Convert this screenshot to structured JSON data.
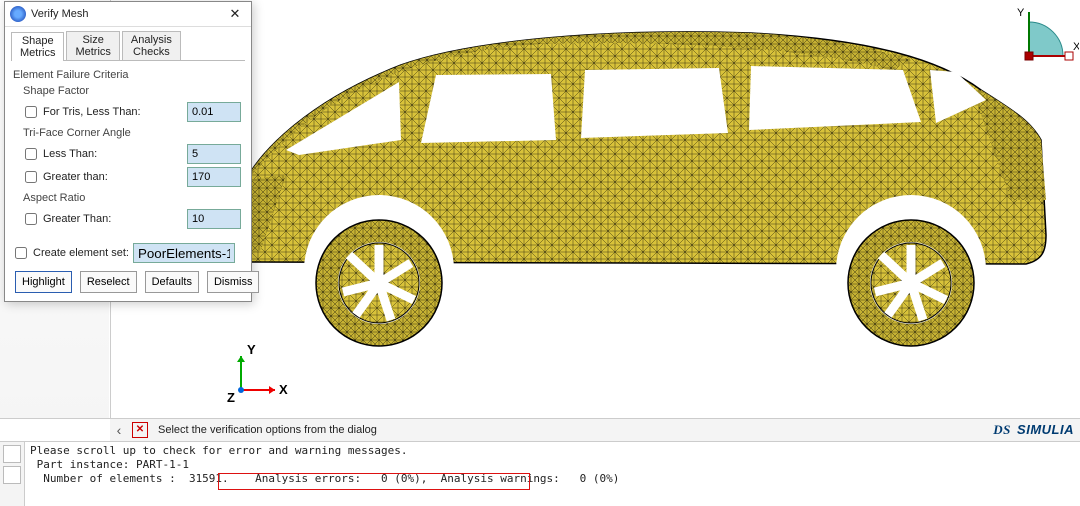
{
  "dialog": {
    "title": "Verify Mesh",
    "tabs": [
      "Shape\nMetrics",
      "Size\nMetrics",
      "Analysis\nChecks"
    ],
    "group_failure": "Element Failure Criteria",
    "shape_factor": {
      "label": "Shape Factor",
      "tris_label": "For Tris, Less Than:",
      "tris_val": "0.01"
    },
    "corner": {
      "label": "Tri-Face Corner Angle",
      "less_label": "Less Than:",
      "less_val": "5",
      "greater_label": "Greater than:",
      "greater_val": "170"
    },
    "aspect": {
      "label": "Aspect Ratio",
      "greater_label": "Greater Than:",
      "greater_val": "10"
    },
    "create_set_label": "Create element set:",
    "create_set_val": "PoorElements-1",
    "btn_highlight": "Highlight",
    "btn_reselect": "Reselect",
    "btn_defaults": "Defaults",
    "btn_dismiss": "Dismiss"
  },
  "hint": "Select the verification options from the dialog",
  "brand_prefix": "DS",
  "brand": "SIMULIA",
  "axes": {
    "y": "Y",
    "x": "X",
    "z": "Z"
  },
  "triad_labels": {
    "y": "Y",
    "x": "X"
  },
  "log_text": "Please scroll up to check for error and warning messages.\n Part instance: PART-1-1\n  Number of elements :  31591.    Analysis errors:   0 (0%),  Analysis warnings:   0 (0%)"
}
